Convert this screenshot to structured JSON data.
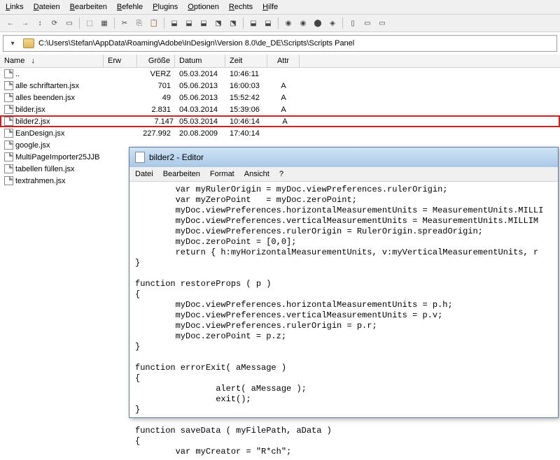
{
  "menubar": [
    "Links",
    "Dateien",
    "Bearbeiten",
    "Befehle",
    "Plugins",
    "Optionen",
    "Rechts",
    "Hilfe"
  ],
  "path": "C:\\Users\\Stefan\\AppData\\Roaming\\Adobe\\InDesign\\Version 8.0\\de_DE\\Scripts\\Scripts Panel",
  "columns": {
    "name": "Name",
    "ext": "Erw",
    "size": "Größe",
    "date": "Datum",
    "time": "Zeit",
    "attr": "Attr"
  },
  "files": [
    {
      "name": "..",
      "ext": "",
      "size": "VERZ",
      "date": "05.03.2014",
      "time": "10:46:11",
      "attr": ""
    },
    {
      "name": "alle schriftarten",
      "ext": "jsx",
      "size": "701",
      "date": "05.06.2013",
      "time": "16:00:03",
      "attr": "A"
    },
    {
      "name": "alles beenden",
      "ext": "jsx",
      "size": "49",
      "date": "05.06.2013",
      "time": "15:52:42",
      "attr": "A"
    },
    {
      "name": "bilder",
      "ext": "jsx",
      "size": "2.831",
      "date": "04.03.2014",
      "time": "15:39:06",
      "attr": "A"
    },
    {
      "name": "bilder2",
      "ext": "jsx",
      "size": "7.147",
      "date": "05.03.2014",
      "time": "10:46:14",
      "attr": "A",
      "hilite": true
    },
    {
      "name": "EanDesign",
      "ext": "jsx",
      "size": "227.992",
      "date": "20.08.2009",
      "time": "17:40:14",
      "attr": ""
    },
    {
      "name": "google",
      "ext": "jsx",
      "size": "",
      "date": "",
      "time": "",
      "attr": ""
    },
    {
      "name": "MultiPageImporter25JJB",
      "ext": "",
      "size": "",
      "date": "",
      "time": "",
      "attr": ""
    },
    {
      "name": "tabellen füllen",
      "ext": "jsx",
      "size": "",
      "date": "",
      "time": "",
      "attr": ""
    },
    {
      "name": "textrahmen",
      "ext": "jsx",
      "size": "",
      "date": "",
      "time": "",
      "attr": ""
    }
  ],
  "editor": {
    "title": "bilder2 - Editor",
    "menu": [
      "Datei",
      "Bearbeiten",
      "Format",
      "Ansicht",
      "?"
    ],
    "code": "        var myRulerOrigin = myDoc.viewPreferences.rulerOrigin;\n        var myZeroPoint   = myDoc.zeroPoint;\n        myDoc.viewPreferences.horizontalMeasurementUnits = MeasurementUnits.MILLI\n        myDoc.viewPreferences.verticalMeasurementUnits = MeasurementUnits.MILLIM\n        myDoc.viewPreferences.rulerOrigin = RulerOrigin.spreadOrigin;\n        myDoc.zeroPoint = [0,0];\n        return { h:myHorizontalMeasurementUnits, v:myVerticalMeasurementUnits, r\n}\n\nfunction restoreProps ( p )\n{\n        myDoc.viewPreferences.horizontalMeasurementUnits = p.h;\n        myDoc.viewPreferences.verticalMeasurementUnits = p.v;\n        myDoc.viewPreferences.rulerOrigin = p.r;\n        myDoc.zeroPoint = p.z;\n}\n\nfunction errorExit( aMessage )\n{\n                alert( aMessage );\n                exit();\n}\n\nfunction saveData ( myFilePath, aData )\n{\n        var myCreator = \"R*ch\";"
  }
}
